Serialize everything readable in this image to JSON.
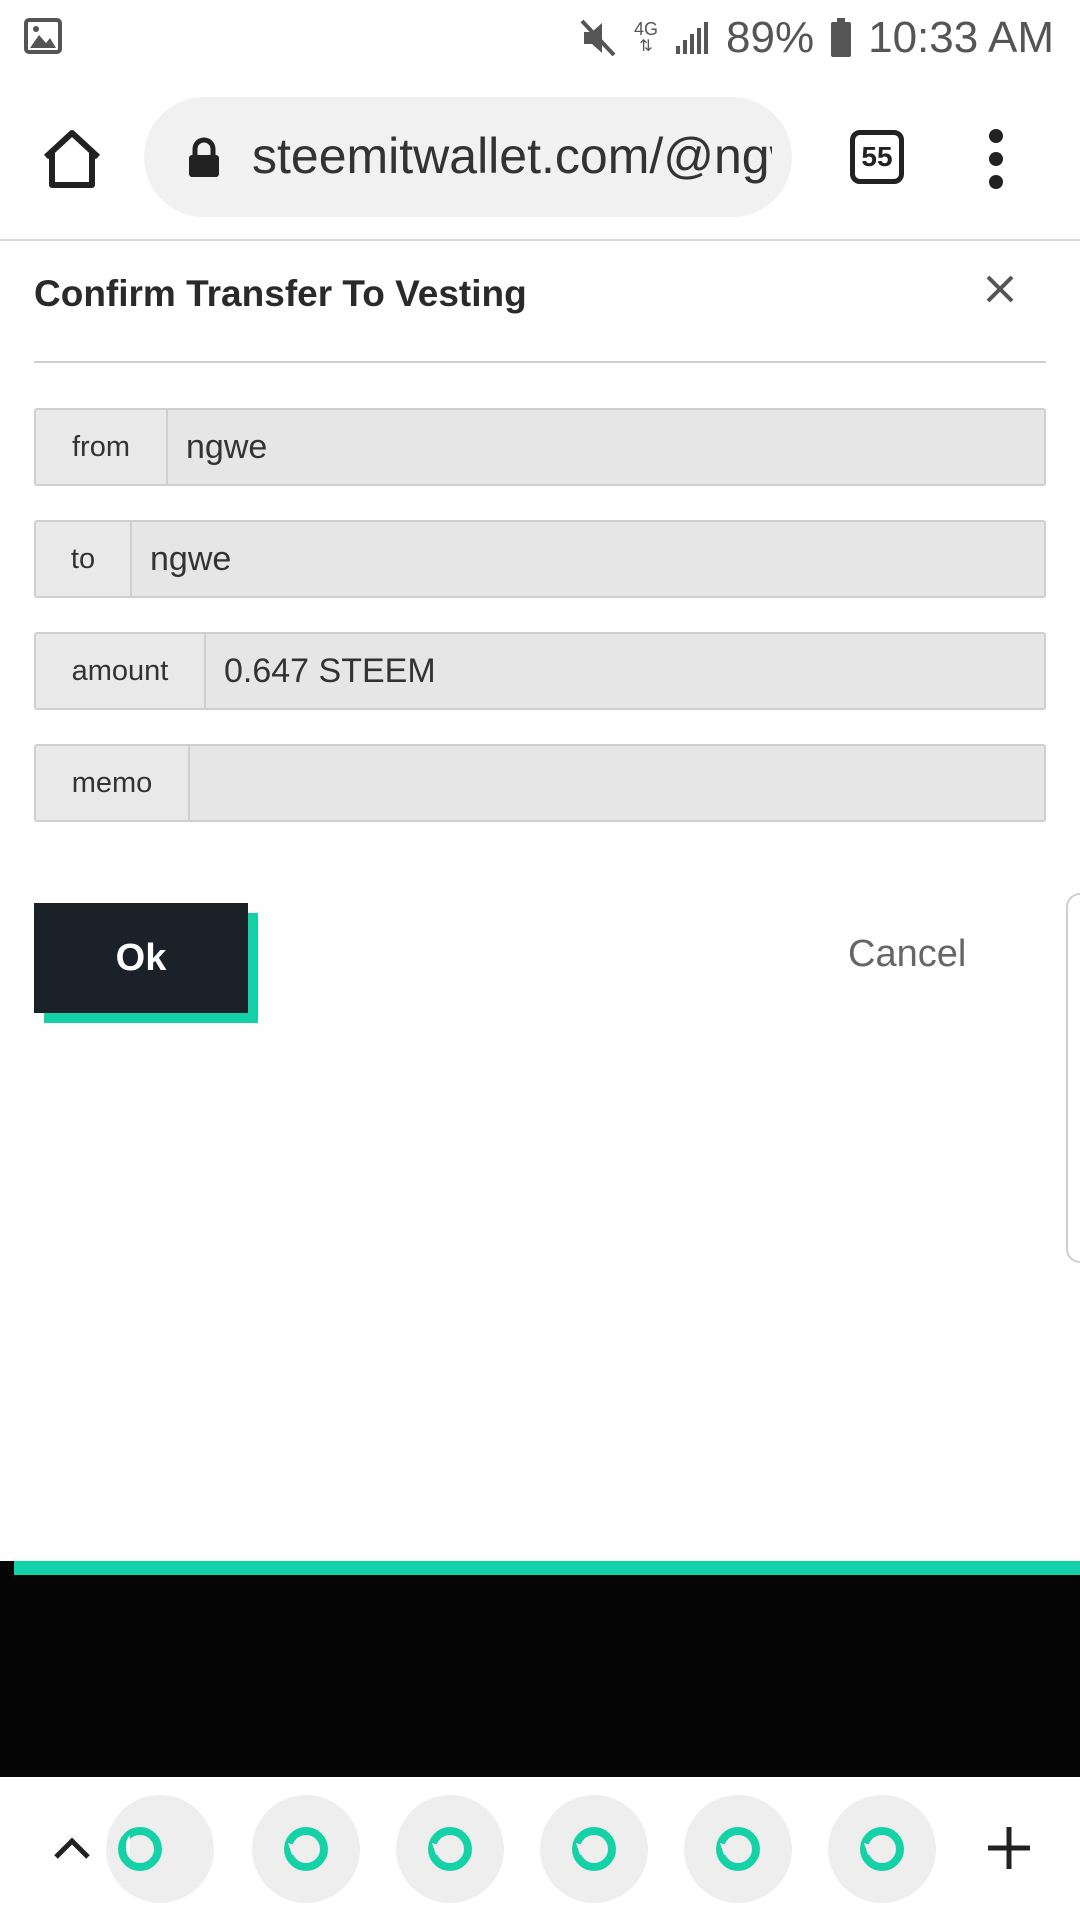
{
  "status_bar": {
    "network": "4G",
    "battery": "89%",
    "time": "10:33 AM"
  },
  "browser": {
    "url": "steemitwallet.com/@ngwe",
    "tab_count": "55"
  },
  "modal": {
    "title": "Confirm Transfer To Vesting",
    "fields": [
      {
        "label": "from",
        "value": "ngwe"
      },
      {
        "label": "to",
        "value": "ngwe"
      },
      {
        "label": "amount",
        "value": "0.647 STEEM"
      },
      {
        "label": "memo",
        "value": ""
      }
    ],
    "ok_label": "Ok",
    "cancel_label": "Cancel"
  },
  "colors": {
    "accent": "#15d1a8",
    "button_dark": "#1a2128"
  },
  "tab_strip": {
    "tabs": [
      "steemit-tab",
      "steemit-tab",
      "steemit-tab",
      "steemit-tab",
      "steemit-tab",
      "steemit-tab"
    ]
  }
}
